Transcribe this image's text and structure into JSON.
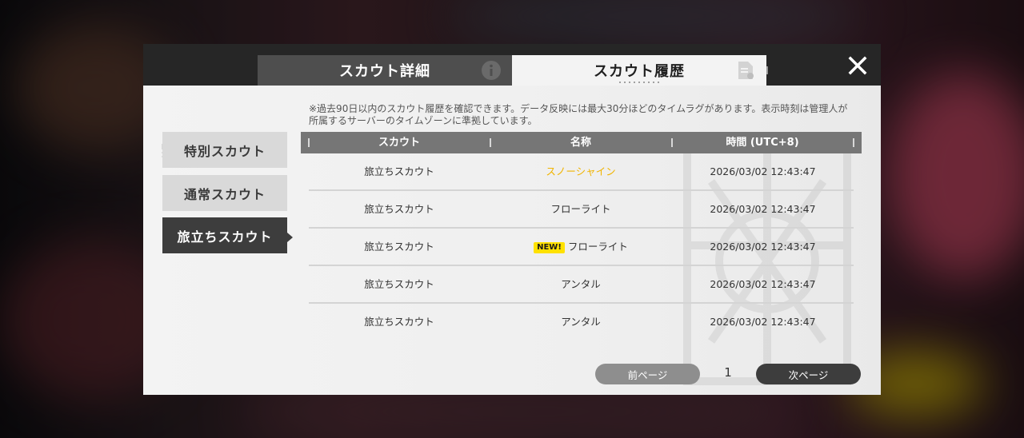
{
  "tabs": [
    {
      "label": "スカウト詳細",
      "icon": "info-icon"
    },
    {
      "label": "スカウト履歴",
      "icon": "document-icon",
      "active": true
    }
  ],
  "close_icon": "close-icon",
  "sidebar": {
    "items": [
      {
        "label": "特別スカウト"
      },
      {
        "label": "通常スカウト"
      },
      {
        "label": "旅立ちスカウト",
        "active": true
      }
    ]
  },
  "notice": "※過去90日以内のスカウト履歴を確認できます。データ反映には最大30分ほどのタイムラグがあります。表示時刻は管理人が所属するサーバーのタイムゾーンに準拠しています。",
  "table": {
    "headers": [
      "スカウト",
      "名称",
      "時間 (UTC+8)"
    ],
    "rows": [
      {
        "scout": "旅立ちスカウト",
        "name": "スノーシャイン",
        "time": "2026/03/02 12:43:47",
        "highlight": true
      },
      {
        "scout": "旅立ちスカウト",
        "name": "フローライト",
        "time": "2026/03/02 12:43:47"
      },
      {
        "scout": "旅立ちスカウト",
        "name": "フローライト",
        "time": "2026/03/02 12:43:47",
        "badge": "NEW!"
      },
      {
        "scout": "旅立ちスカウト",
        "name": "アンタル",
        "time": "2026/03/02 12:43:47"
      },
      {
        "scout": "旅立ちスカウト",
        "name": "アンタル",
        "time": "2026/03/02 12:43:47"
      }
    ]
  },
  "pager": {
    "prev": "前ページ",
    "page": "1",
    "next": "次ページ"
  },
  "colors": {
    "highlight": "#f0b400",
    "badge": "#ffe100",
    "active": "#3d3d3d"
  }
}
